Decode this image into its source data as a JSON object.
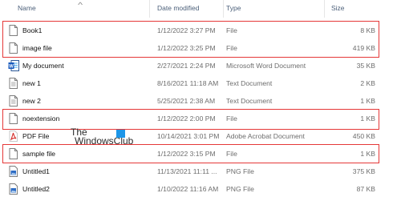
{
  "columns": {
    "name": "Name",
    "date": "Date modified",
    "type": "Type",
    "size": "Size"
  },
  "sort_icon": "caret-up-icon",
  "rows": [
    {
      "name": "Book1",
      "date": "1/12/2022 3:27 PM",
      "type": "File",
      "size": "8 KB",
      "icon": "blank-file-icon"
    },
    {
      "name": "image file",
      "date": "1/12/2022 3:25 PM",
      "type": "File",
      "size": "419 KB",
      "icon": "blank-file-icon"
    },
    {
      "name": "My document",
      "date": "2/27/2021 2:24 PM",
      "type": "Microsoft Word Document",
      "size": "35 KB",
      "icon": "word-document-icon"
    },
    {
      "name": "new 1",
      "date": "8/16/2021 11:18 AM",
      "type": "Text Document",
      "size": "2 KB",
      "icon": "text-document-icon"
    },
    {
      "name": "new 2",
      "date": "5/25/2021 2:38 AM",
      "type": "Text Document",
      "size": "1 KB",
      "icon": "text-document-icon"
    },
    {
      "name": "noextension",
      "date": "1/12/2022 2:00 PM",
      "type": "File",
      "size": "1 KB",
      "icon": "blank-file-icon"
    },
    {
      "name": "PDF File",
      "date": "10/14/2021 3:01 PM",
      "type": "Adobe Acrobat Document",
      "size": "450 KB",
      "icon": "pdf-file-icon"
    },
    {
      "name": "sample file",
      "date": "1/12/2022 3:15 PM",
      "type": "File",
      "size": "1 KB",
      "icon": "blank-file-icon"
    },
    {
      "name": "Untitled1",
      "date": "11/13/2021 11:11 ...",
      "type": "PNG File",
      "size": "375 KB",
      "icon": "png-image-icon"
    },
    {
      "name": "Untitled2",
      "date": "1/10/2022 11:16 AM",
      "type": "PNG File",
      "size": "87 KB",
      "icon": "png-image-icon"
    }
  ],
  "watermark": {
    "line1": "The",
    "line2": "WindowsClub"
  },
  "colors": {
    "highlight": "#e53838",
    "header_text": "#4c607a",
    "secondary_text": "#6d6d6d"
  }
}
